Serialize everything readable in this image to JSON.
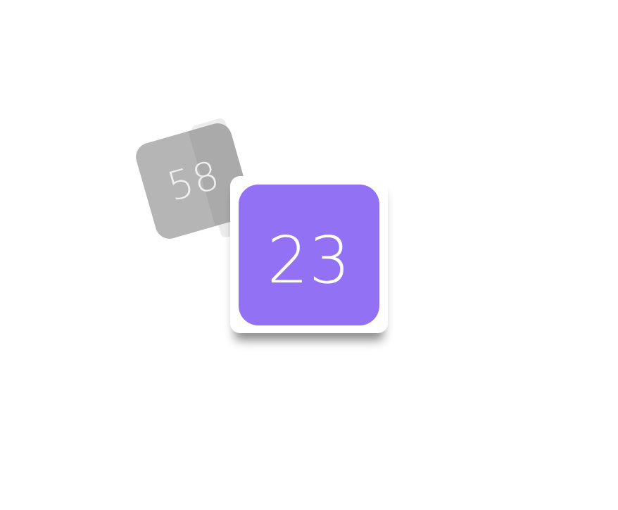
{
  "tiles": {
    "back": {
      "label": "58",
      "color": "#b5b5b5"
    },
    "front": {
      "label": "23",
      "color": "#9271f4",
      "frame_color": "#ffffff"
    }
  }
}
